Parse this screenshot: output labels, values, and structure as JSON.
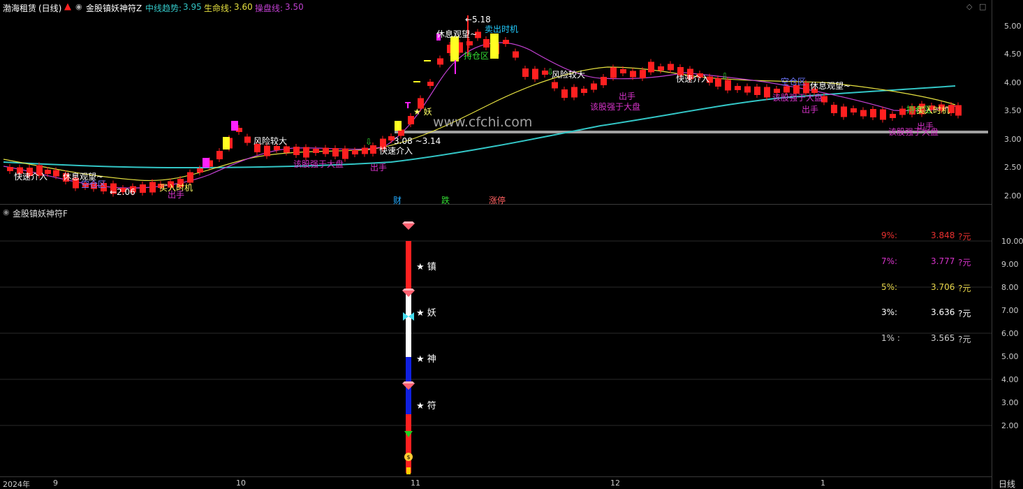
{
  "header": {
    "symbol": "渤海租赁",
    "period": "(日线)",
    "indicator": "金股镇妖神符Z",
    "mid_label": "中线趋势:",
    "mid_value": "3.95",
    "life_label": "生命线:",
    "life_value": "3.60",
    "control_label": "操盘线:",
    "control_value": "3.50"
  },
  "price_axis": [
    "5.00",
    "4.50",
    "4.00",
    "3.50",
    "3.00",
    "2.50",
    "2.00"
  ],
  "annotations": {
    "high": "←5.18",
    "low": "←2.06",
    "risk_big": "风险较大",
    "risk_big2": "风险较大",
    "fast_entry": "快速介入",
    "fast_entry2": "快速介入",
    "fast_entry3": "快速介入",
    "rest_watch": "休息观望~",
    "rest_watch2": "休息观望~",
    "rest_watch3": "休息观望~",
    "empty_zone": "空仓区",
    "empty_zone2": "空仓区",
    "hold_zone": "持仓区",
    "hold_zone2": "持仓区",
    "buy_time": "买入时机",
    "buy_time2": "买入时机",
    "sell_time": "卖出时机",
    "stronger": "该股强于大盘",
    "stronger2": "该股强于大盘",
    "stronger3": "该股强于大盘",
    "stronger4": "该股强于大盘",
    "exit": "出手",
    "exit2": "出手",
    "exit3": "出手",
    "exit4": "出手",
    "exit5": "出手",
    "range": "3.08 ~3.14",
    "yao_mark": "★ 妖",
    "t_mark": "T",
    "watermark": "www.cfchi.com"
  },
  "event_labels": {
    "cai": "财",
    "die": "跌",
    "zhangting": "涨停"
  },
  "panel2": {
    "title": "金股镇妖神符F",
    "chars": [
      "★ 镇",
      "★ 妖",
      "★ 神",
      "★ 符"
    ],
    "targets": [
      {
        "pct": "9%:",
        "price": "3.848",
        "unit": "?元",
        "color": "#e8302f"
      },
      {
        "pct": "7%:",
        "price": "3.777",
        "unit": "?元",
        "color": "#d633c9"
      },
      {
        "pct": "5%:",
        "price": "3.706",
        "unit": "?元",
        "color": "#e8d64a"
      },
      {
        "pct": "3%:",
        "price": "3.636",
        "unit": "?元",
        "color": "#ffffff"
      },
      {
        "pct": "1% :",
        "price": "3.565",
        "unit": "?元",
        "color": "#cccccc"
      }
    ],
    "axis": [
      "10.00",
      "9.00",
      "8.00",
      "7.00",
      "6.00",
      "5.00",
      "4.00",
      "3.00",
      "2.00"
    ]
  },
  "date_axis": {
    "year": "2024年",
    "months": [
      "9",
      "10",
      "11",
      "12",
      "1"
    ],
    "period_button": "日线"
  },
  "colors": {
    "up": "#ff2020",
    "down_hollow": "#ff2020",
    "mid_trend": "#33c6c6",
    "life_line": "#e5e040",
    "control_line": "#c040d0",
    "support": "#a0a0a0"
  }
}
